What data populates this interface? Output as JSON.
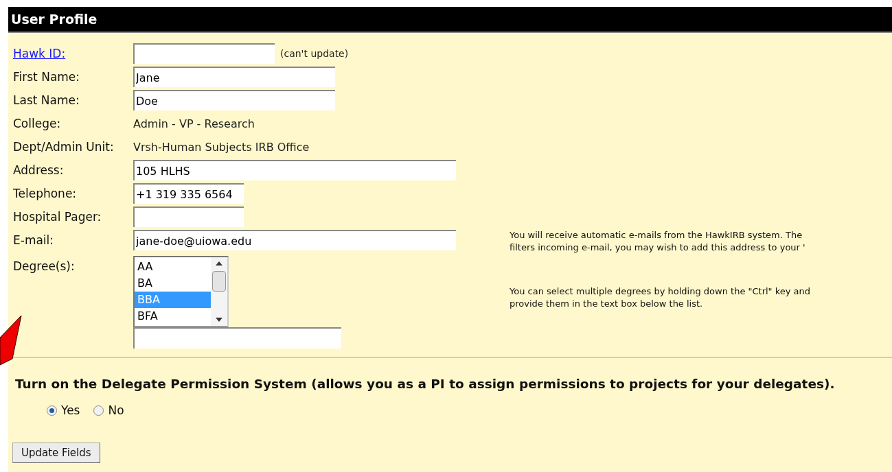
{
  "header": {
    "title": "User Profile"
  },
  "fields": [
    {
      "kind": "input",
      "link": true,
      "label": "Hawk ID:",
      "note": "(can't update)"
    },
    {
      "kind": "input",
      "link": false,
      "label": "First Name:",
      "value": "Jane"
    },
    {
      "kind": "input",
      "link": false,
      "label": "Last Name:",
      "value": "Doe"
    },
    {
      "kind": "static",
      "link": false,
      "label": "College:",
      "value": "Admin - VP - Research"
    },
    {
      "kind": "static",
      "link": false,
      "label": "Dept/Admin Unit:",
      "value": "Vrsh-Human Subjects IRB Office"
    },
    {
      "kind": "input",
      "link": false,
      "label": "Address:",
      "value": "105 HLHS"
    },
    {
      "kind": "input",
      "link": false,
      "label": "Telephone:",
      "value": "+1 319 335 6564"
    },
    {
      "kind": "input",
      "link": false,
      "label": "Hospital Pager:"
    },
    {
      "kind": "input",
      "link": false,
      "label": "E-mail:",
      "value": "jane-doe@uiowa.edu",
      "info": [
        "You will receive automatic e-mails from the HawkIRB system. The",
        "filters incoming e-mail, you may wish to add this address to your '"
      ]
    },
    {
      "kind": "listbox",
      "link": false,
      "label": "Degree(s):",
      "options": [
        {
          "label": "AA",
          "selected": false
        },
        {
          "label": "BA",
          "selected": false
        },
        {
          "label": "BBA",
          "selected": true
        },
        {
          "label": "BFA",
          "selected": false
        }
      ],
      "info": [
        "You can select multiple degrees by holding down the \"Ctrl\" key and",
        "provide them in the text box below the list."
      ]
    }
  ],
  "delegate": {
    "question": "Turn on the Delegate Permission System (allows you as a PI to assign permissions to projects for your delegates).",
    "options": [
      {
        "label": "Yes",
        "selected": true
      },
      {
        "label": "No",
        "selected": false
      }
    ]
  },
  "buttons": [
    "Update Fields"
  ]
}
